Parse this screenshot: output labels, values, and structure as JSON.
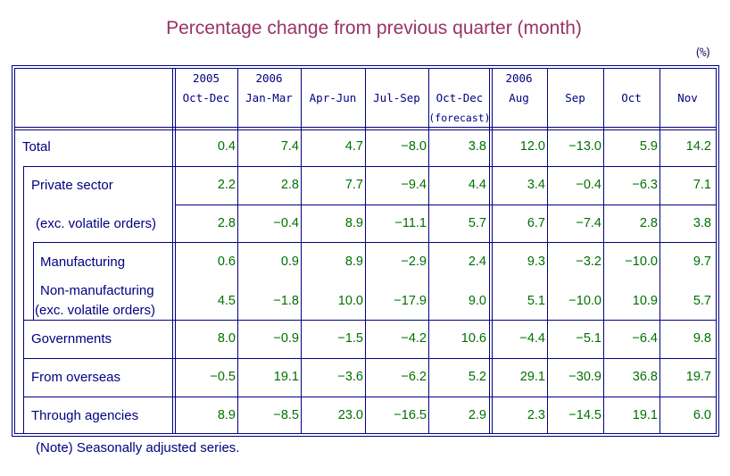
{
  "title": "Percentage change from previous quarter (month)",
  "unit": "(%)",
  "columns": [
    {
      "year": "2005",
      "period": "Oct-Dec",
      "sub": ""
    },
    {
      "year": "2006",
      "period": "Jan-Mar",
      "sub": ""
    },
    {
      "year": "",
      "period": "Apr-Jun",
      "sub": ""
    },
    {
      "year": "",
      "period": "Jul-Sep",
      "sub": ""
    },
    {
      "year": "",
      "period": "Oct-Dec",
      "sub": "(forecast)"
    },
    {
      "year": "2006",
      "period": "Aug",
      "sub": ""
    },
    {
      "year": "",
      "period": "Sep",
      "sub": ""
    },
    {
      "year": "",
      "period": "Oct",
      "sub": ""
    },
    {
      "year": "",
      "period": "Nov",
      "sub": ""
    }
  ],
  "rows": [
    {
      "label": "Total",
      "values": [
        "0.4",
        "7.4",
        "4.7",
        "−8.0",
        "3.8",
        "12.0",
        "−13.0",
        "5.9",
        "14.2"
      ]
    },
    {
      "label": "Private sector",
      "values": [
        "2.2",
        "2.8",
        "7.7",
        "−9.4",
        "4.4",
        "3.4",
        "−0.4",
        "−6.3",
        "7.1"
      ]
    },
    {
      "label": "(exc. volatile orders)",
      "values": [
        "2.8",
        "−0.4",
        "8.9",
        "−11.1",
        "5.7",
        "6.7",
        "−7.4",
        "2.8",
        "3.8"
      ]
    },
    {
      "label": "Manufacturing",
      "values": [
        "0.6",
        "0.9",
        "8.9",
        "−2.9",
        "2.4",
        "9.3",
        "−3.2",
        "−10.0",
        "9.7"
      ]
    },
    {
      "label": "Non-manufacturing",
      "label2": "(exc. volatile orders)",
      "values": [
        "4.5",
        "−1.8",
        "10.0",
        "−17.9",
        "9.0",
        "5.1",
        "−10.0",
        "10.9",
        "5.7"
      ]
    },
    {
      "label": "Governments",
      "values": [
        "8.0",
        "−0.9",
        "−1.5",
        "−4.2",
        "10.6",
        "−4.4",
        "−5.1",
        "−6.4",
        "9.8"
      ]
    },
    {
      "label": "From overseas",
      "values": [
        "−0.5",
        "19.1",
        "−3.6",
        "−6.2",
        "5.2",
        "29.1",
        "−30.9",
        "36.8",
        "19.7"
      ]
    },
    {
      "label": "Through agencies",
      "values": [
        "8.9",
        "−8.5",
        "23.0",
        "−16.5",
        "2.9",
        "2.3",
        "−14.5",
        "19.1",
        "6.0"
      ]
    }
  ],
  "note": "(Note) Seasonally adjusted series."
}
